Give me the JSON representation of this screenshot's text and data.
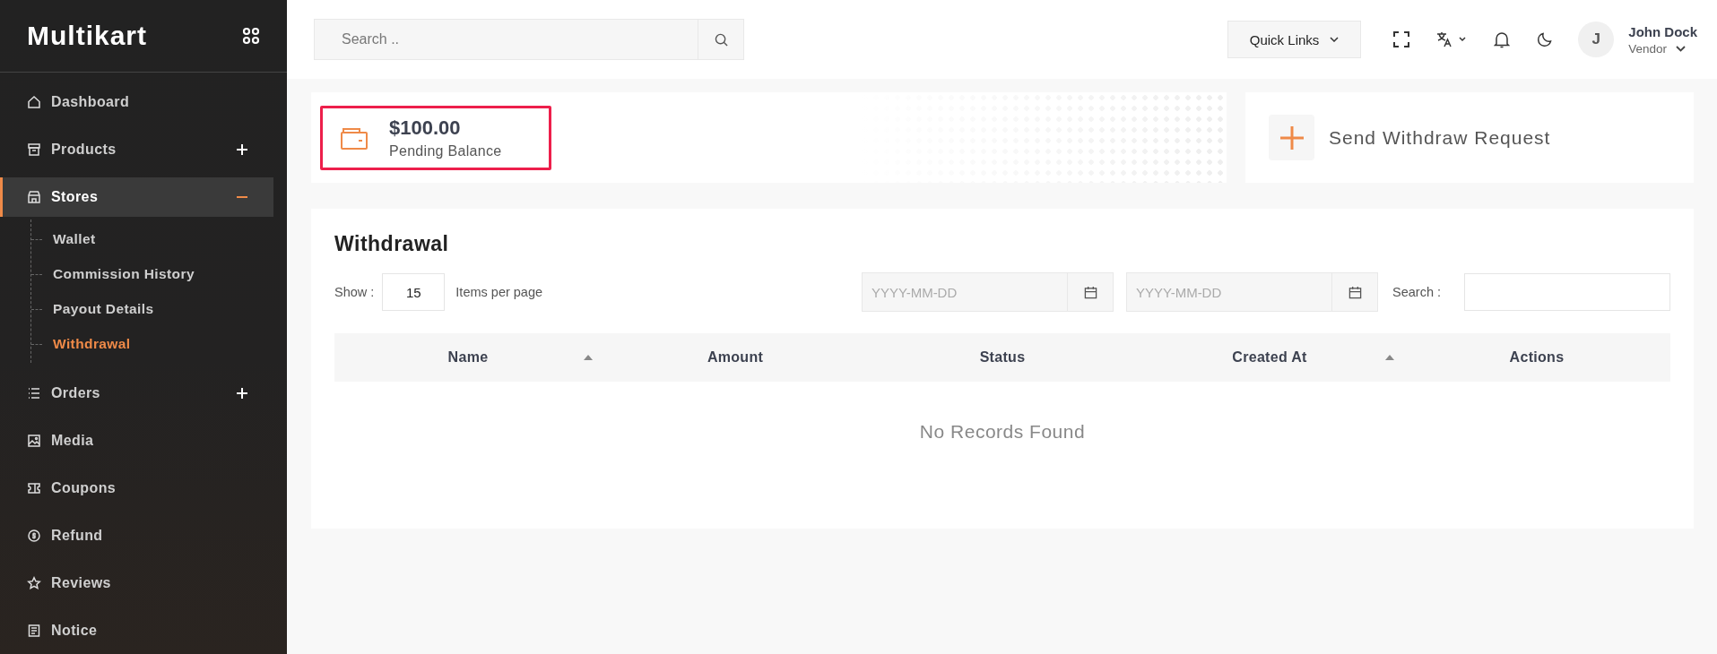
{
  "sidebar": {
    "logo": "Multikart",
    "items": [
      {
        "label": "Dashboard",
        "selected": false
      },
      {
        "label": "Products",
        "selected": false,
        "expanded": false
      },
      {
        "label": "Stores",
        "selected": true,
        "expanded": true,
        "children": [
          {
            "label": "Wallet",
            "selected": false
          },
          {
            "label": "Commission History",
            "selected": false
          },
          {
            "label": "Payout Details",
            "selected": false
          },
          {
            "label": "Withdrawal",
            "selected": true
          }
        ]
      },
      {
        "label": "Orders",
        "selected": false,
        "expanded": false
      },
      {
        "label": "Media",
        "selected": false
      },
      {
        "label": "Coupons",
        "selected": false
      },
      {
        "label": "Refund",
        "selected": false
      },
      {
        "label": "Reviews",
        "selected": false
      },
      {
        "label": "Notice",
        "selected": false
      }
    ]
  },
  "header": {
    "search": {
      "placeholder": "Search .."
    },
    "quick_links": "Quick Links",
    "user": {
      "initial": "J",
      "name": "John Dock",
      "role": "Vendor"
    }
  },
  "balance_card": {
    "amount": "$100.00",
    "label": "Pending Balance",
    "highlighted": true
  },
  "withdraw_button": "Send Withdraw Request",
  "withdrawal": {
    "title": "Withdrawal",
    "show_label": "Show :",
    "per_page": "15",
    "per_page_label": "Items per page",
    "date_from": {
      "placeholder": "YYYY-MM-DD"
    },
    "date_to": {
      "placeholder": "YYYY-MM-DD"
    },
    "search_label": "Search :",
    "table": {
      "columns": [
        {
          "label": "Name",
          "sortable": true
        },
        {
          "label": "Amount",
          "sortable": false
        },
        {
          "label": "Status",
          "sortable": false
        },
        {
          "label": "Created At",
          "sortable": true
        },
        {
          "label": "Actions",
          "sortable": false
        }
      ],
      "empty_message": "No Records Found"
    }
  }
}
